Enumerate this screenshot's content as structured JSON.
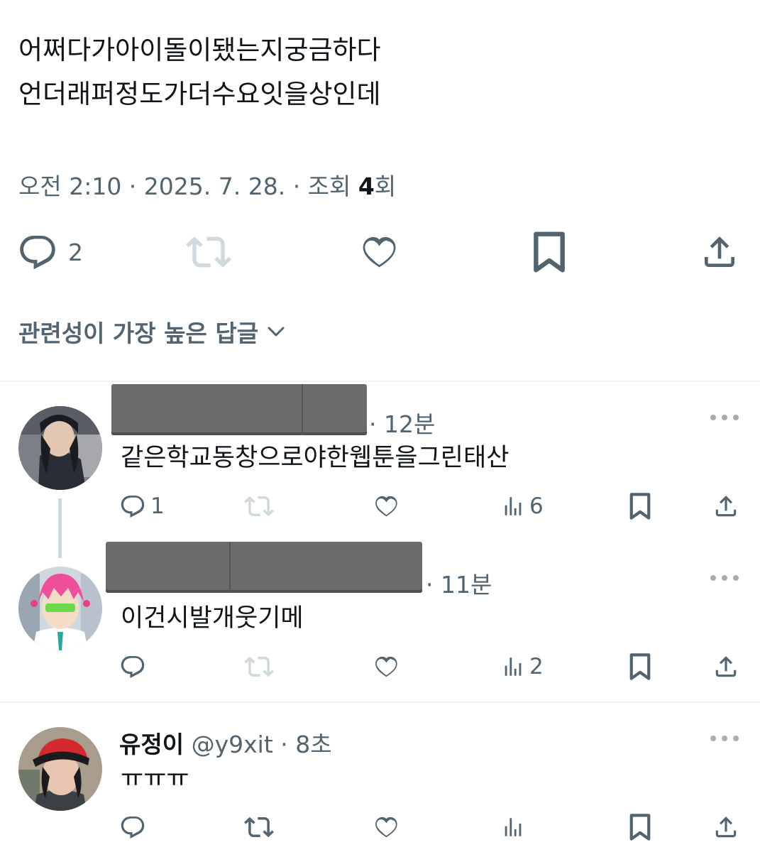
{
  "tweet": {
    "lines": [
      "어쩌다가아이돌이됐는지궁금하다",
      "언더래퍼정도가더수요잇을상인데"
    ],
    "time": "오전 2:10 · 2025. 7. 28. · 조회 ",
    "views": "4",
    "views_suffix": "회",
    "reply_count": "2"
  },
  "sort_label": "관련성이 가장 높은 답글",
  "replies": [
    {
      "time": "· 12분",
      "text": "같은학교동창으로야한웹툰을그린태산",
      "reply_count": "1",
      "view_count": "6"
    },
    {
      "time": "· 11분",
      "text": "이건시발개웃기메",
      "reply_count": "",
      "view_count": "2"
    },
    {
      "name": "유정이",
      "handle": "@y9xit",
      "time": "· 8초",
      "text": "ㅠㅠㅠ",
      "reply_count": "",
      "view_count": ""
    }
  ],
  "colors": {
    "text": "#0f1419",
    "secondary": "#536471",
    "divider": "#eff3f4",
    "disabled": "#cfd9de"
  }
}
